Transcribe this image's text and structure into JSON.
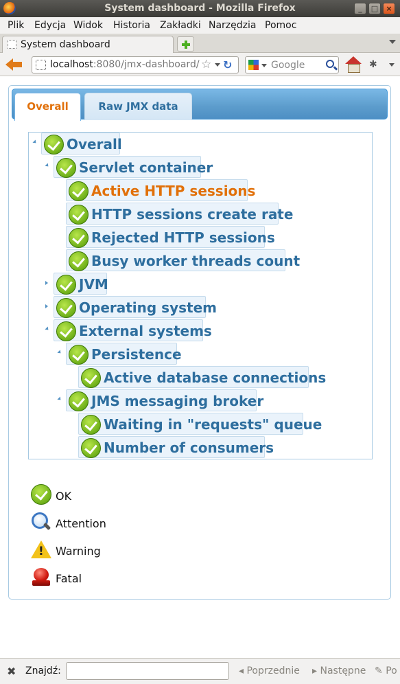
{
  "window": {
    "title": "System dashboard - Mozilla Firefox"
  },
  "menu": {
    "items": [
      "Plik",
      "Edycja",
      "Widok",
      "Historia",
      "Zakładki",
      "Narzędzia",
      "Pomoc"
    ]
  },
  "browser_tab": {
    "label": "System dashboard"
  },
  "navbar": {
    "url_host": "localhost",
    "url_rest": ":8080/jmx-dashboard/",
    "search_placeholder": "Google"
  },
  "page": {
    "tabs": [
      {
        "label": "Overall",
        "active": true
      },
      {
        "label": "Raw JMX data",
        "active": false
      }
    ],
    "tree": [
      {
        "label": "Overall",
        "level": 0,
        "state": "open",
        "selected": false
      },
      {
        "label": "Servlet container",
        "level": 1,
        "state": "open",
        "selected": false
      },
      {
        "label": "Active HTTP sessions",
        "level": 2,
        "state": "leaf",
        "selected": true
      },
      {
        "label": "HTTP sessions create rate",
        "level": 2,
        "state": "leaf",
        "selected": false
      },
      {
        "label": "Rejected HTTP sessions",
        "level": 2,
        "state": "leaf",
        "selected": false
      },
      {
        "label": "Busy worker threads count",
        "level": 2,
        "state": "leaf",
        "selected": false
      },
      {
        "label": "JVM",
        "level": 1,
        "state": "closed",
        "selected": false
      },
      {
        "label": "Operating system",
        "level": 1,
        "state": "closed",
        "selected": false
      },
      {
        "label": "External systems",
        "level": 1,
        "state": "open",
        "selected": false
      },
      {
        "label": "Persistence",
        "level": 2,
        "state": "open",
        "selected": false
      },
      {
        "label": "Active database connections",
        "level": 3,
        "state": "leaf",
        "selected": false
      },
      {
        "label": "JMS messaging broker",
        "level": 2,
        "state": "open",
        "selected": false
      },
      {
        "label": "Waiting in \"requests\" queue",
        "level": 3,
        "state": "leaf",
        "selected": false
      },
      {
        "label": "Number of consumers",
        "level": 3,
        "state": "leaf",
        "selected": false
      }
    ],
    "legend": [
      {
        "label": "OK",
        "icon": "ok-icon"
      },
      {
        "label": "Attention",
        "icon": "magnifier-icon"
      },
      {
        "label": "Warning",
        "icon": "warning-triangle-icon"
      },
      {
        "label": "Fatal",
        "icon": "alarm-bell-icon"
      }
    ]
  },
  "findbar": {
    "label": "Znajdź:",
    "prev": "Poprzednie",
    "next": "Następne",
    "highlight": "Po"
  }
}
